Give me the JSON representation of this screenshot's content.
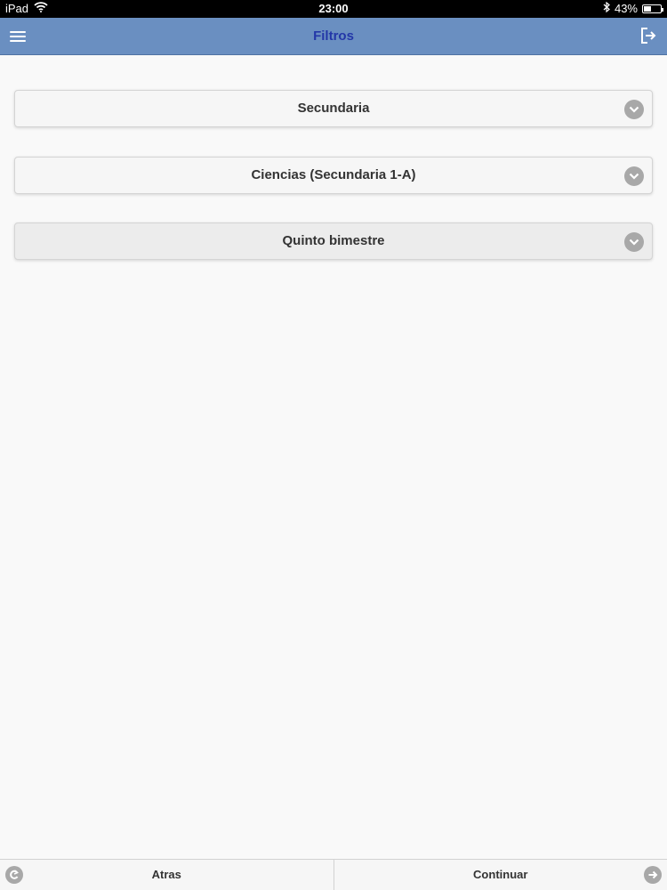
{
  "status_bar": {
    "device": "iPad",
    "time": "23:00",
    "battery_percent_label": "43%",
    "battery_level": 0.43,
    "icons": [
      "wifi-icon",
      "bluetooth-icon",
      "battery-icon"
    ]
  },
  "header": {
    "title": "Filtros",
    "menu_icon": "hamburger-menu-icon",
    "logout_icon": "logout-icon"
  },
  "filters": [
    {
      "label": "Secundaria"
    },
    {
      "label": "Ciencias (Secundaria 1-A)"
    },
    {
      "label": "Quinto bimestre"
    }
  ],
  "footer": {
    "back_label": "Atras",
    "back_icon": "arrow-left-circle-icon",
    "continue_label": "Continuar",
    "continue_icon": "arrow-right-circle-icon"
  },
  "colors": {
    "header_bg": "#6a8fc1",
    "header_title": "#2337a8",
    "page_bg": "#f9f9f9",
    "icon_gray": "#a8a8a8"
  }
}
